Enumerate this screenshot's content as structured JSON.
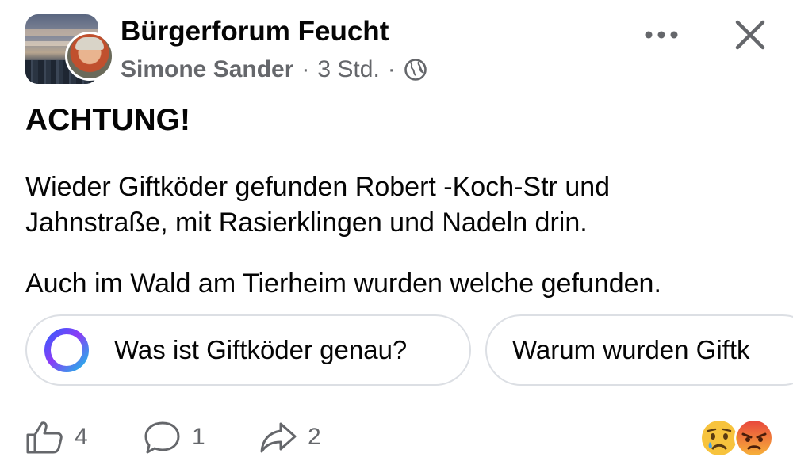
{
  "header": {
    "group_name": "Bürgerforum Feucht",
    "author": "Simone Sander",
    "separator": "·",
    "time": "3 Std.",
    "audience_icon": "globe-icon",
    "more_icon": "more-horizontal-icon",
    "close_icon": "close-icon"
  },
  "post": {
    "title": "ACHTUNG!",
    "paragraphs": [
      "Wieder Giftköder gefunden Robert -Koch-Str und Jahnstraße, mit Rasierklingen und Nadeln drin.",
      "Auch im Wald am Tierheim wurden welche gefunden."
    ]
  },
  "suggestions": [
    {
      "label": "Was ist Giftköder genau?",
      "icon": "ai-ring-icon"
    },
    {
      "label": "Warum wurden Giftk"
    }
  ],
  "actions": {
    "like_count": "4",
    "comment_count": "1",
    "share_count": "2"
  },
  "reactions": [
    "sad-face-icon",
    "angry-face-icon"
  ],
  "colors": {
    "text_primary": "#050505",
    "text_secondary": "#65676b",
    "chip_border": "#dcdfe4"
  }
}
